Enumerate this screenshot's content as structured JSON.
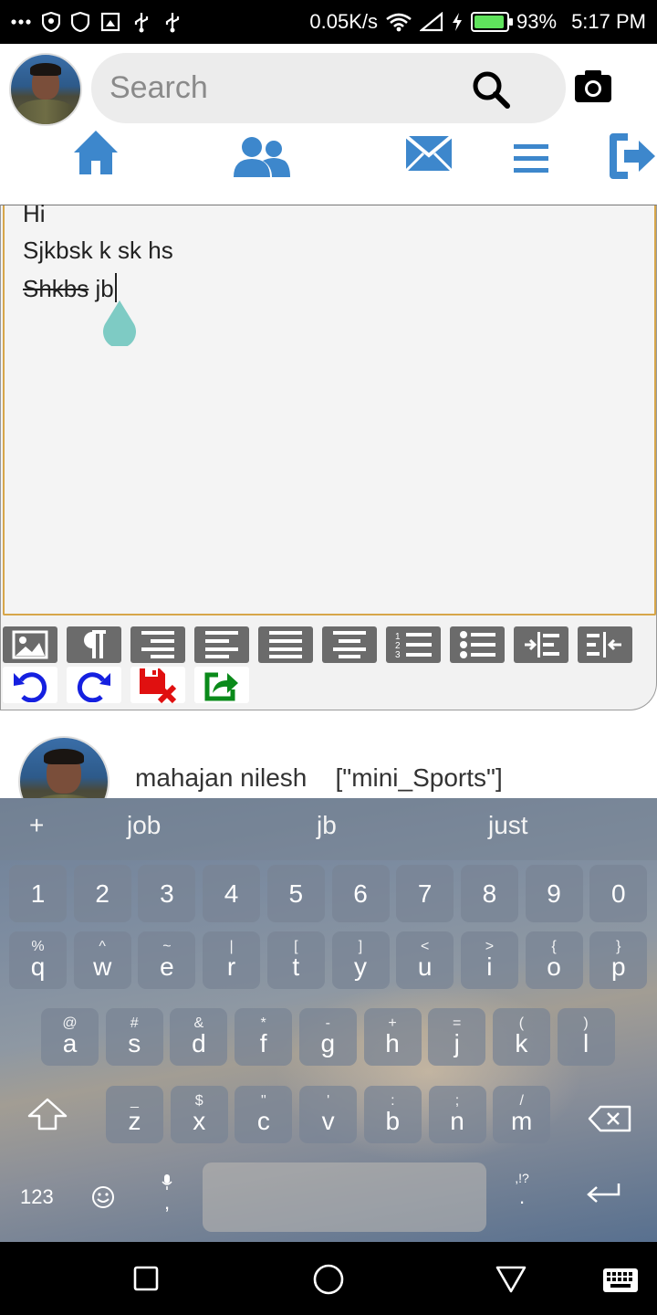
{
  "status_bar": {
    "network_speed": "0.05K/s",
    "battery_percent": "93%",
    "battery_level": 0.93,
    "time": "5:17 PM",
    "icons": [
      "more-dots-icon",
      "shield-icon",
      "shield-outline-icon",
      "screenshot-icon",
      "usb-icon",
      "usb-icon",
      "wifi-icon",
      "signal-icon",
      "charging-icon",
      "battery-icon"
    ]
  },
  "header": {
    "search": {
      "placeholder": "Search",
      "value": ""
    },
    "nav_icons": [
      "home-icon",
      "friends-icon",
      "messages-icon",
      "menu-icon",
      "logout-icon"
    ],
    "colors": {
      "accent": "#3d87cc"
    }
  },
  "editor": {
    "lines": [
      "Hi",
      "Sjkbsk k sk hs",
      "Shkbs",
      " jb"
    ],
    "border_color": "#d7a64a",
    "handle_color": "#7ecbc4",
    "toolbar_row1": [
      "image-icon",
      "paragraph-icon",
      "align-right-icon",
      "align-left-icon",
      "align-justify-icon",
      "align-center-icon",
      "ordered-list-icon",
      "unordered-list-icon",
      "indent-icon",
      "outdent-icon"
    ],
    "toolbar_row2": [
      "undo-icon",
      "redo-icon",
      "discard-save-icon",
      "share-icon"
    ]
  },
  "feed": {
    "author": "mahajan nilesh",
    "tags": "[\"mini_Sports\"]"
  },
  "keyboard": {
    "suggestions": [
      "+",
      "job",
      "jb",
      "just"
    ],
    "number_row": [
      "1",
      "2",
      "3",
      "4",
      "5",
      "6",
      "7",
      "8",
      "9",
      "0"
    ],
    "row1": [
      {
        "top": "%",
        "main": "q"
      },
      {
        "top": "^",
        "main": "w"
      },
      {
        "top": "~",
        "main": "e"
      },
      {
        "top": "|",
        "main": "r"
      },
      {
        "top": "[",
        "main": "t"
      },
      {
        "top": "]",
        "main": "y"
      },
      {
        "top": "<",
        "main": "u"
      },
      {
        "top": ">",
        "main": "i"
      },
      {
        "top": "{",
        "main": "o"
      },
      {
        "top": "}",
        "main": "p"
      }
    ],
    "row2": [
      {
        "top": "@",
        "main": "a"
      },
      {
        "top": "#",
        "main": "s"
      },
      {
        "top": "&",
        "main": "d"
      },
      {
        "top": "*",
        "main": "f"
      },
      {
        "top": "-",
        "main": "g"
      },
      {
        "top": "+",
        "main": "h"
      },
      {
        "top": "=",
        "main": "j"
      },
      {
        "top": "(",
        "main": "k"
      },
      {
        "top": ")",
        "main": "l"
      }
    ],
    "row3": [
      {
        "top": "_",
        "main": "z"
      },
      {
        "top": "$",
        "main": "x"
      },
      {
        "top": "\"",
        "main": "c"
      },
      {
        "top": "'",
        "main": "v"
      },
      {
        "top": ":",
        "main": "b"
      },
      {
        "top": ";",
        "main": "n"
      },
      {
        "top": "/",
        "main": "m"
      }
    ],
    "symbols_label": "123",
    "comma": ",",
    "period": ".",
    "period_hint": ",!?"
  },
  "navbar": {
    "icons": [
      "recents-icon",
      "home-circle-icon",
      "back-icon",
      "keyboard-switch-icon"
    ]
  }
}
